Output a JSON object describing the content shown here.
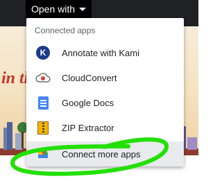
{
  "toolbar": {
    "open_with_label": "Open with"
  },
  "banner": {
    "partial_text": "in th"
  },
  "menu": {
    "header": "Connected apps",
    "items": [
      {
        "label": "Annotate with Kami",
        "icon": "kami-icon"
      },
      {
        "label": "CloudConvert",
        "icon": "cloudconvert-icon"
      },
      {
        "label": "Google Docs",
        "icon": "google-docs-icon"
      },
      {
        "label": "ZIP Extractor",
        "icon": "zip-extractor-icon"
      },
      {
        "label": "Connect more apps",
        "icon": "marketplace-icon"
      }
    ]
  },
  "colors": {
    "annotation_highlight": "#22e000",
    "hover_bg": "#e8eaed",
    "topbar": "#202124"
  }
}
